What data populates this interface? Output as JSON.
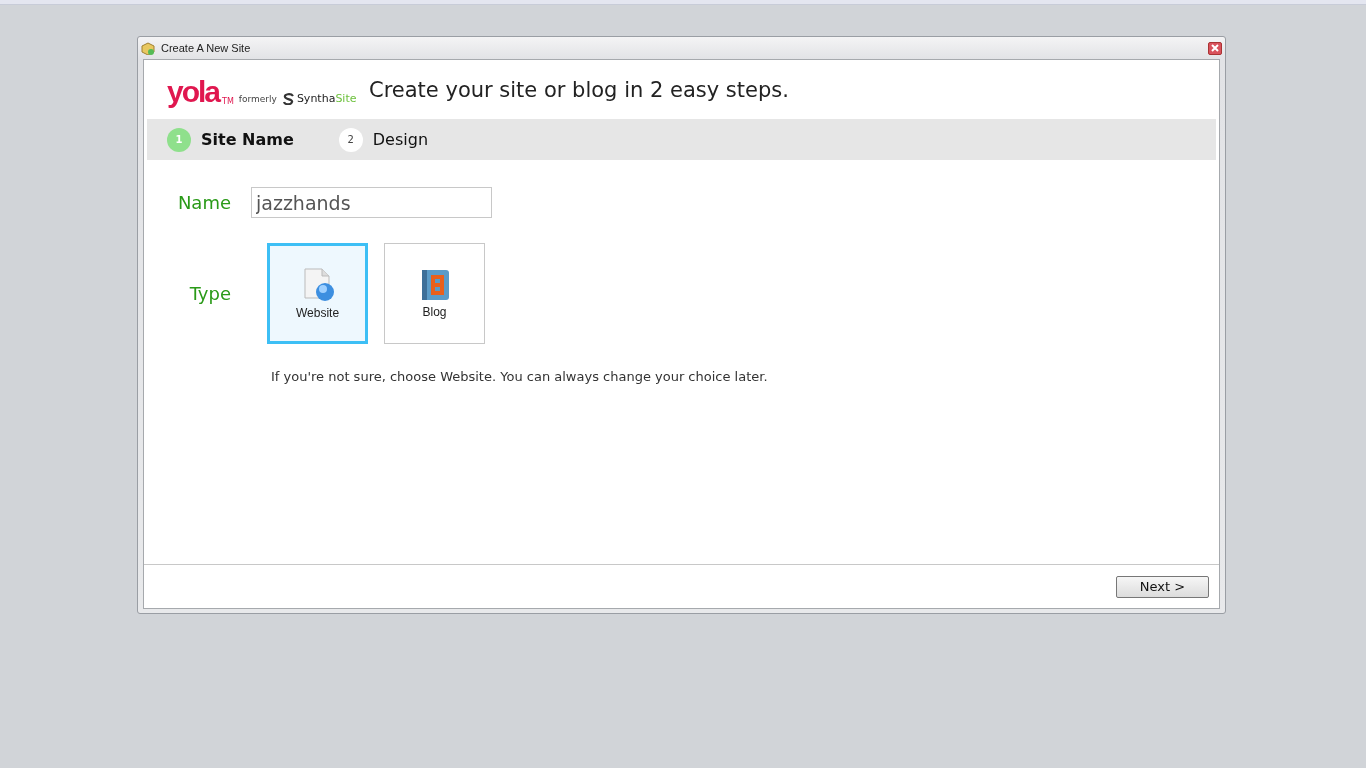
{
  "window": {
    "title": "Create A New Site"
  },
  "logo": {
    "brand": "yola",
    "tm": "TM",
    "formerly": "formerly",
    "old_name_a": "Syntha",
    "old_name_b": "Site"
  },
  "heading": "Create your site or blog in 2 easy steps.",
  "steps": [
    {
      "number": "1",
      "label": "Site Name",
      "selected": true
    },
    {
      "number": "2",
      "label": "Design",
      "selected": false
    }
  ],
  "name_field": {
    "label": "Name",
    "value": "jazzhands"
  },
  "type_field": {
    "label": "Type",
    "options": [
      {
        "kind": "website",
        "label": "Website",
        "selected": true
      },
      {
        "kind": "blog",
        "label": "Blog",
        "selected": false
      }
    ]
  },
  "hint": "If you're not sure, choose Website. You can always change your choice later.",
  "buttons": [
    {
      "label": "Next >"
    }
  ]
}
